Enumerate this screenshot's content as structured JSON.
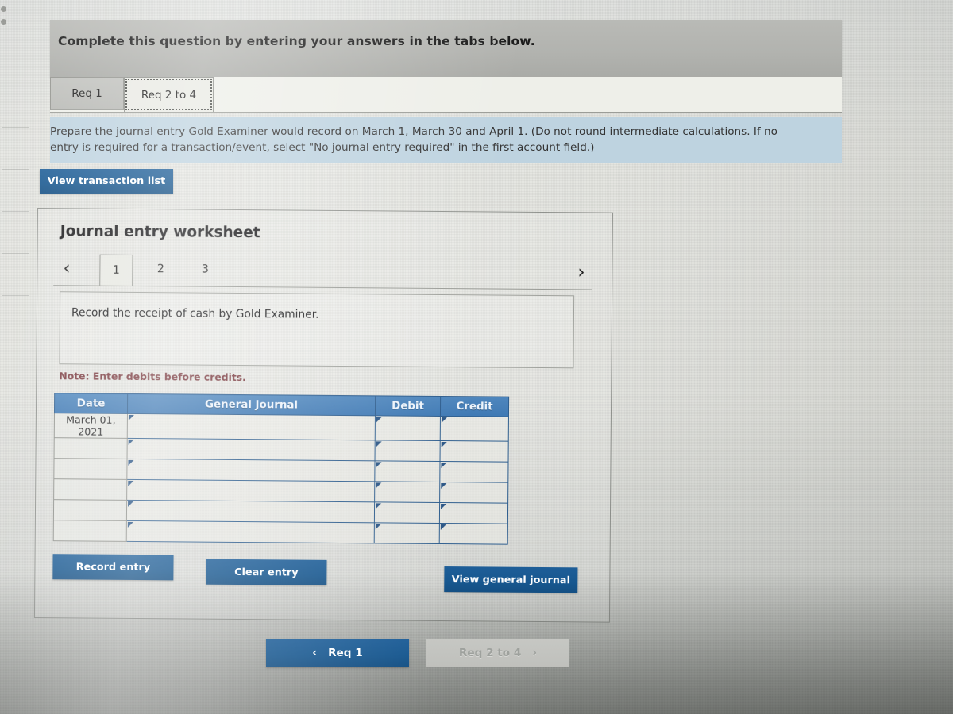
{
  "header": {
    "title": "Complete this question by entering your answers in the tabs below."
  },
  "tabs": [
    {
      "id": "req-1",
      "label": "Req 1",
      "active": false
    },
    {
      "id": "req-2-to-4",
      "label": "Req 2 to 4",
      "active": true
    }
  ],
  "instruction": {
    "line1": "Prepare the journal entry Gold Examiner would record on March 1, March 30 and April 1. (Do not round intermediate calculations. If no",
    "line2": "entry is required for a transaction/event, select \"No journal entry required\" in the first account field.)"
  },
  "buttons": {
    "view_transaction_list": "View transaction list",
    "record_entry": "Record entry",
    "clear_entry": "Clear entry",
    "view_general_journal": "View general journal"
  },
  "worksheet": {
    "title": "Journal entry worksheet",
    "pager": {
      "prev_icon": "chevron-left-icon",
      "next_icon": "chevron-right-icon",
      "prev_glyph": "‹",
      "next_glyph": "›",
      "pages": [
        "1",
        "2",
        "3"
      ],
      "active_page": "1"
    },
    "description": "Record the receipt of cash by Gold Examiner.",
    "note": "Note: Enter debits before credits.",
    "table": {
      "columns": [
        "Date",
        "General Journal",
        "Debit",
        "Credit"
      ],
      "rows": [
        {
          "date": "March 01, 2021",
          "general_journal": "",
          "debit": "",
          "credit": ""
        },
        {
          "date": "",
          "general_journal": "",
          "debit": "",
          "credit": ""
        },
        {
          "date": "",
          "general_journal": "",
          "debit": "",
          "credit": ""
        },
        {
          "date": "",
          "general_journal": "",
          "debit": "",
          "credit": ""
        },
        {
          "date": "",
          "general_journal": "",
          "debit": "",
          "credit": ""
        },
        {
          "date": "",
          "general_journal": "",
          "debit": "",
          "credit": ""
        }
      ]
    }
  },
  "bottom_nav": {
    "prev_label": "Req 1",
    "prev_arrow": "‹",
    "next_label": "Req 2 to 4",
    "next_arrow": "›",
    "next_disabled": true
  },
  "colors": {
    "accent_blue": "#17578f",
    "table_header_blue": "#3f79b4",
    "instruction_bg": "#bed3e0",
    "header_bar_gray": "#b2b3af",
    "note_red": "#7a3a3f",
    "disabled_gray": "#c6c7c3"
  }
}
